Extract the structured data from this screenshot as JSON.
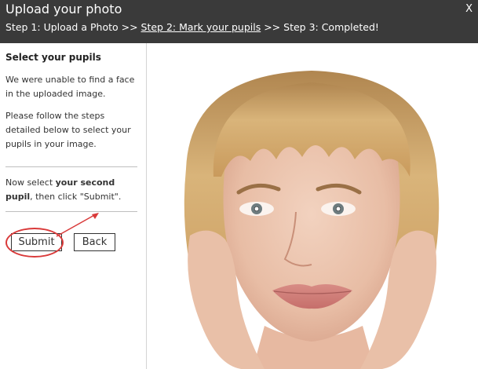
{
  "header": {
    "title": "Upload your photo",
    "close_label": "X",
    "step1": "Step 1: Upload a Photo >> ",
    "step2": "Step 2: Mark your pupils",
    "step3": " >> Step 3: Completed!"
  },
  "sidebar": {
    "title": "Select your pupils",
    "para1": "We were unable to find a face in the uploaded image.",
    "para2": "Please follow the steps detailed below to select your pupils in your image.",
    "instruction_prefix": "Now select ",
    "instruction_bold": "your second pupil",
    "instruction_suffix": ", then click \"Submit\"."
  },
  "buttons": {
    "submit": "Submit",
    "back": "Back"
  },
  "colors": {
    "header_bg": "#3a3a3a",
    "annotation": "#d93a3a"
  }
}
